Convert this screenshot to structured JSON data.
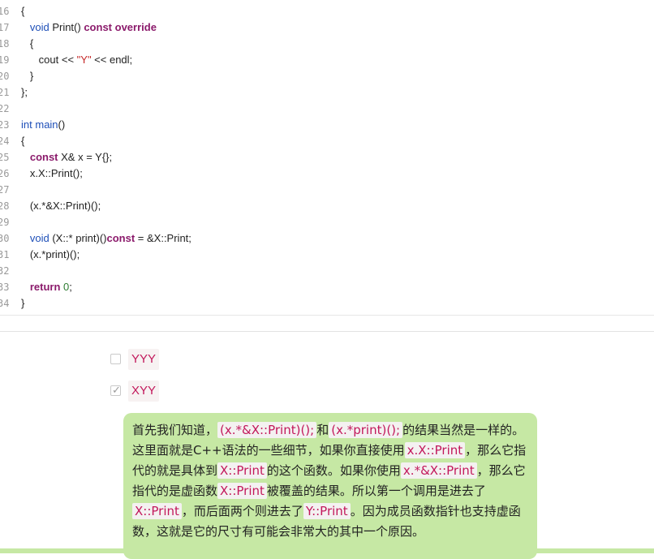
{
  "code": {
    "lines": [
      {
        "num": "16",
        "tokens": [
          {
            "t": "{",
            "c": "plain"
          }
        ]
      },
      {
        "num": "17",
        "tokens": [
          {
            "t": "   ",
            "c": "plain"
          },
          {
            "t": "void",
            "c": "type"
          },
          {
            "t": " Print() ",
            "c": "plain"
          },
          {
            "t": "const",
            "c": "kw"
          },
          {
            "t": " ",
            "c": "plain"
          },
          {
            "t": "override",
            "c": "kw"
          }
        ]
      },
      {
        "num": "18",
        "tokens": [
          {
            "t": "   {",
            "c": "plain"
          }
        ]
      },
      {
        "num": "19",
        "tokens": [
          {
            "t": "      cout << ",
            "c": "plain"
          },
          {
            "t": "\"Y\"",
            "c": "str"
          },
          {
            "t": " << endl;",
            "c": "plain"
          }
        ]
      },
      {
        "num": "20",
        "tokens": [
          {
            "t": "   }",
            "c": "plain"
          }
        ]
      },
      {
        "num": "21",
        "tokens": [
          {
            "t": "};",
            "c": "plain"
          }
        ]
      },
      {
        "num": "22",
        "tokens": []
      },
      {
        "num": "23",
        "tokens": [
          {
            "t": "int",
            "c": "type"
          },
          {
            "t": " ",
            "c": "plain"
          },
          {
            "t": "main",
            "c": "fn"
          },
          {
            "t": "()",
            "c": "plain"
          }
        ]
      },
      {
        "num": "24",
        "tokens": [
          {
            "t": "{",
            "c": "plain"
          }
        ]
      },
      {
        "num": "25",
        "tokens": [
          {
            "t": "   ",
            "c": "plain"
          },
          {
            "t": "const",
            "c": "kw"
          },
          {
            "t": " X& x = Y{};",
            "c": "plain"
          }
        ]
      },
      {
        "num": "26",
        "tokens": [
          {
            "t": "   x.X::Print();",
            "c": "plain"
          }
        ]
      },
      {
        "num": "27",
        "tokens": []
      },
      {
        "num": "28",
        "tokens": [
          {
            "t": "   (x.*&X::Print)();",
            "c": "plain"
          }
        ]
      },
      {
        "num": "29",
        "tokens": []
      },
      {
        "num": "30",
        "tokens": [
          {
            "t": "   ",
            "c": "plain"
          },
          {
            "t": "void",
            "c": "type"
          },
          {
            "t": " (X::* print)()",
            "c": "plain"
          },
          {
            "t": "const",
            "c": "kw"
          },
          {
            "t": " = &X::Print;",
            "c": "plain"
          }
        ]
      },
      {
        "num": "31",
        "tokens": [
          {
            "t": "   (x.*print)();",
            "c": "plain"
          }
        ]
      },
      {
        "num": "32",
        "tokens": []
      },
      {
        "num": "33",
        "tokens": [
          {
            "t": "   ",
            "c": "plain"
          },
          {
            "t": "return",
            "c": "kw"
          },
          {
            "t": " ",
            "c": "plain"
          },
          {
            "t": "0",
            "c": "num"
          },
          {
            "t": ";",
            "c": "plain"
          }
        ]
      },
      {
        "num": "34",
        "tokens": [
          {
            "t": "}",
            "c": "plain"
          }
        ]
      }
    ]
  },
  "options": [
    {
      "label": "YYY",
      "checked": false
    },
    {
      "label": "XYY",
      "checked": true
    }
  ],
  "checkmark_glyph": "✓",
  "explanation": {
    "parts": [
      {
        "t": "首先我们知道，",
        "code": false
      },
      {
        "t": "(x.*&X::Print)();",
        "code": true
      },
      {
        "t": "和",
        "code": false
      },
      {
        "t": "(x.*print)();",
        "code": true
      },
      {
        "t": "的结果当然是一样的。这里面就是C++语法的一些细节，如果你直接使用",
        "code": false
      },
      {
        "t": "x.X::Print",
        "code": true
      },
      {
        "t": "，那么它指代的就是具体到",
        "code": false
      },
      {
        "t": "X::Print",
        "code": true
      },
      {
        "t": "的这个函数。如果你使用",
        "code": false
      },
      {
        "t": "x.*&X::Print",
        "code": true
      },
      {
        "t": "，那么它指代的是虚函数",
        "code": false
      },
      {
        "t": "X::Print",
        "code": true
      },
      {
        "t": "被覆盖的结果。所以第一个调用是进去了",
        "code": false
      },
      {
        "t": "X::Print",
        "code": true
      },
      {
        "t": "，而后面两个则进去了",
        "code": false
      },
      {
        "t": "Y::Print",
        "code": true
      },
      {
        "t": "。因为成员函数指针也支持虚函数，这就是它的尺寸有可能会非常大的其中一个原因。",
        "code": false
      }
    ]
  },
  "colors": {
    "keyword": "#8b1a6b",
    "type": "#1e4fb8",
    "string": "#c62828",
    "number": "#2e7d32",
    "inline_code": "#c2185b",
    "explain_bg": "#c6e8a4"
  }
}
